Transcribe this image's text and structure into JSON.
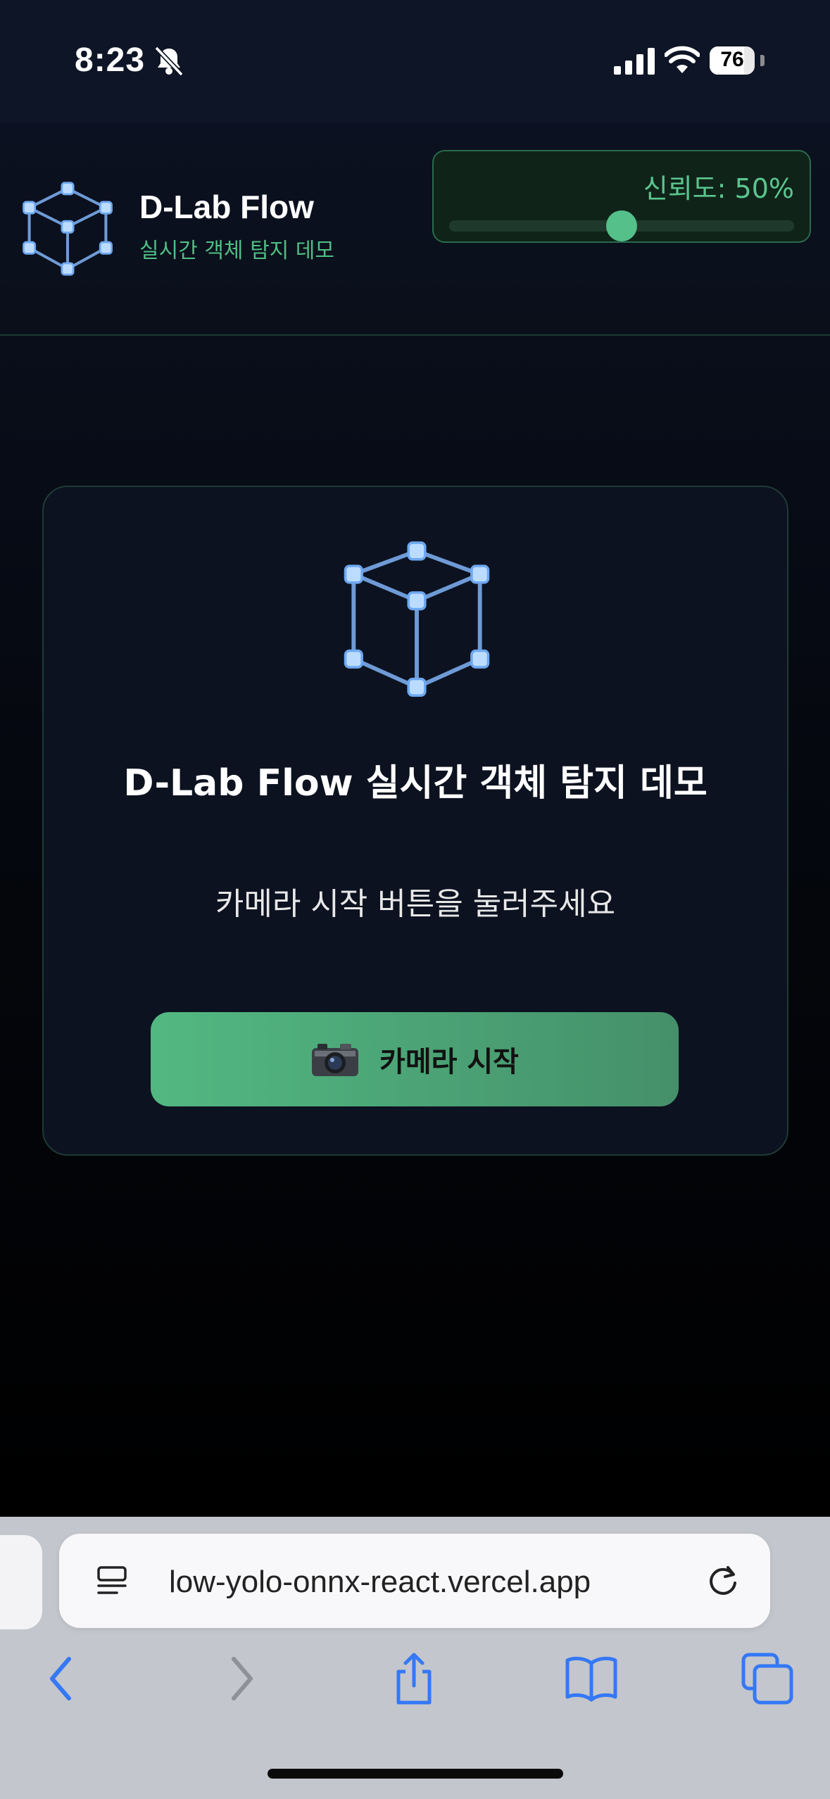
{
  "status_bar": {
    "time": "8:23",
    "battery_level": "76",
    "icons": [
      "bell-slash-icon",
      "signal-icon",
      "wifi-icon",
      "battery-icon"
    ]
  },
  "header": {
    "title": "D-Lab Flow",
    "subtitle": "실시간 객체 탐지 데모",
    "confidence_label": "신뢰도: 50%",
    "confidence_value": 0.5
  },
  "card": {
    "title": "D-Lab Flow 실시간 객체 탐지 데모",
    "instruction": "카메라 시작 버튼을 눌러주세요",
    "start_button_label": "카메라 시작",
    "start_button_icon": "camera-icon"
  },
  "browser": {
    "url": "low-yolo-onnx-react.vercel.app",
    "nav_icons": [
      "back-icon",
      "forward-icon",
      "share-icon",
      "bookmarks-icon",
      "tabs-icon"
    ]
  },
  "colors": {
    "accent": "#4fbf85",
    "background": "#0b1120",
    "card": "#0c1220"
  }
}
